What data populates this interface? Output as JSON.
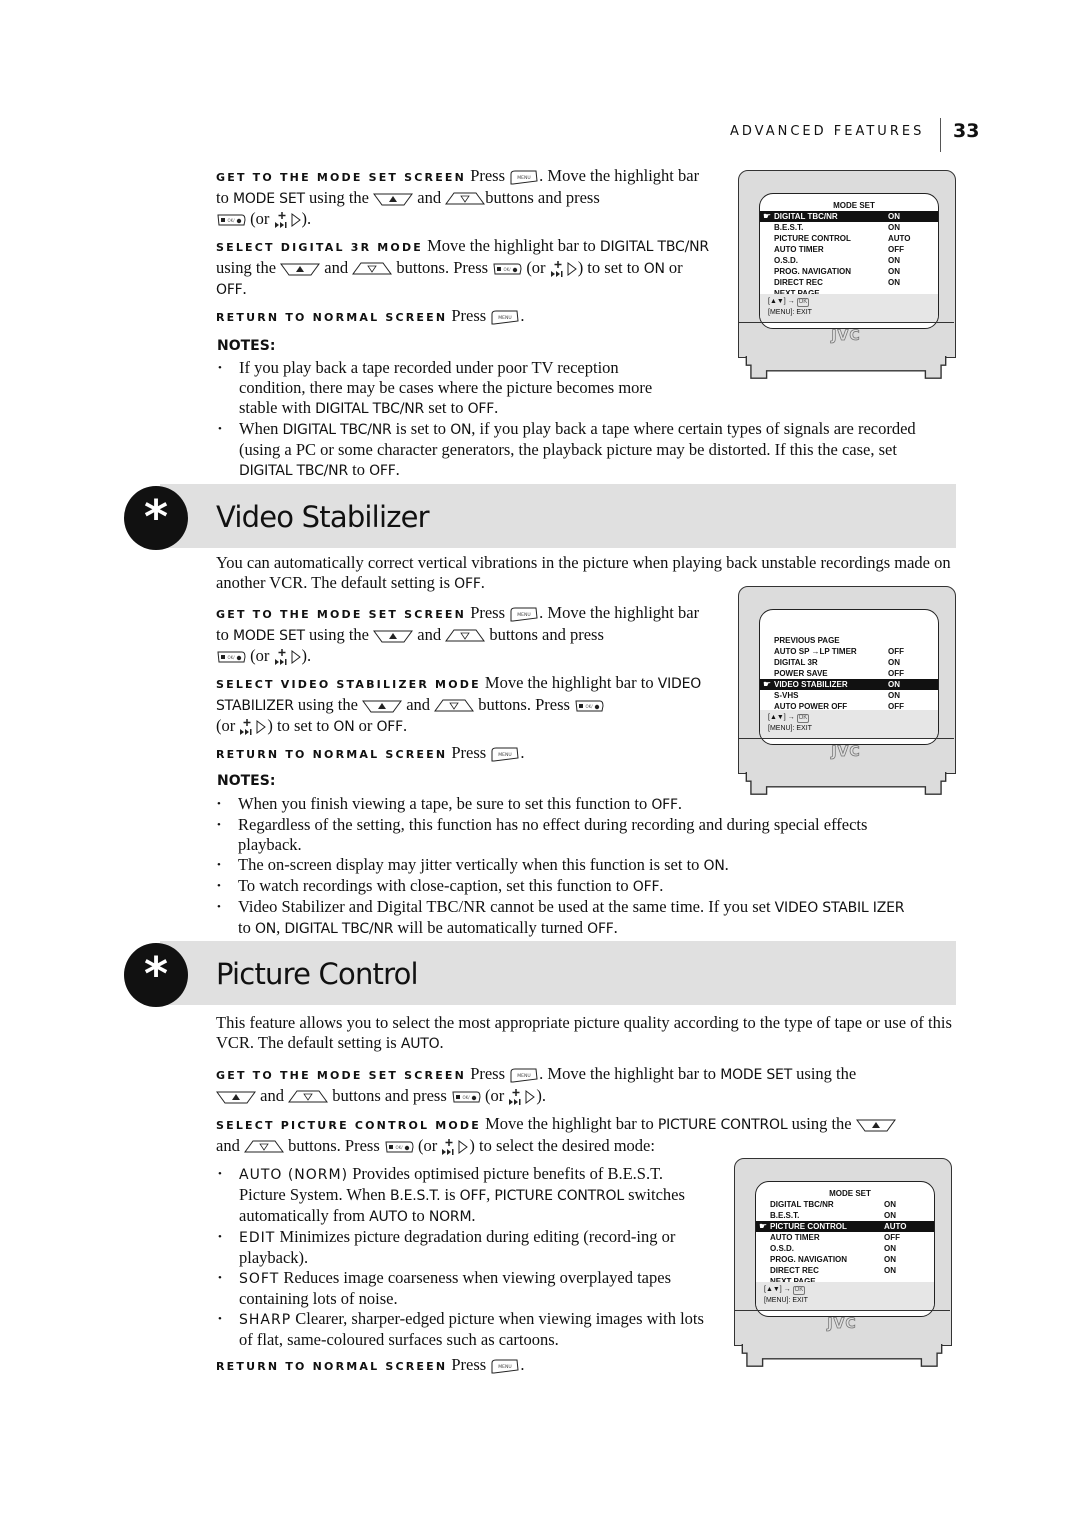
{
  "header": {
    "section": "ADVANCED FEATURES",
    "page_number": "33"
  },
  "icons": {
    "menu": "menu-button-icon",
    "up": "up-arrow-button-icon",
    "down": "down-arrow-button-icon",
    "ok": "ok-button-icon",
    "plus_next": "plus-skip-button-icon",
    "right": "right-triangle-icon",
    "section": "asterisk-icon"
  },
  "digital3r": {
    "get": {
      "lead": "GET TO THE MODE SET SCREEN",
      "t1": " Press ",
      "t2": ". Move the highlight bar to ",
      "b1": "MODE SET",
      "t3": " using the ",
      "t4": " and ",
      "t5": "buttons and press ",
      "t6": " (or ",
      "t7": ")."
    },
    "select": {
      "lead": "SELECT DIGITAL 3R MODE",
      "t1": " Move the highlight bar to ",
      "b1": "DIGITAL TBC/NR",
      "t2": " using the ",
      "t3": " and ",
      "t4": " buttons. Press ",
      "t5": " (or ",
      "t6": ") to set to ",
      "b2": "ON",
      "t7": " or ",
      "b3": "OFF",
      "t8": "."
    },
    "return": {
      "lead": "RETURN TO NORMAL SCREEN",
      "t1": "  Press ",
      "t2": "."
    },
    "notes_heading": "NOTES:",
    "notes": [
      {
        "a": "If you play back a tape recorded under poor TV reception condition, there may be cases where the picture becomes more stable with ",
        "b": "DIGITAL TBC/NR",
        "c": " set to ",
        "d": "OFF",
        "e": "."
      },
      {
        "a": "When ",
        "b": "DIGITAL TBC/NR",
        "c": " is set to ",
        "d": "ON",
        "e": ", if you play back a tape where certain types of signals are recorded (using a PC or some character generators, the playback picture may be distorted. If this the case, set ",
        "f": "DIGITAL TBC/NR",
        "g": " to ",
        "h": "OFF",
        "i": "."
      }
    ],
    "tv": {
      "title": "MODE SET",
      "rows": [
        {
          "label": "DIGITAL TBC/NR",
          "value": "ON",
          "highlighted": true
        },
        {
          "label": "B.E.S.T.",
          "value": "ON"
        },
        {
          "label": "PICTURE CONTROL",
          "value": "AUTO"
        },
        {
          "label": "AUTO TIMER",
          "value": "OFF"
        },
        {
          "label": "O.S.D.",
          "value": "ON"
        },
        {
          "label": "PROG. NAVIGATION",
          "value": "ON"
        },
        {
          "label": "DIRECT REC",
          "value": "ON"
        },
        {
          "label": "NEXT PAGE",
          "value": ""
        }
      ],
      "help1_pre": "[▲▼] → ",
      "help1_ok": "OK",
      "help2": "[MENU]: EXIT",
      "brand": "JVC"
    }
  },
  "video_stabilizer": {
    "title": "Video Stabilizer",
    "intro_a": "You can automatically correct vertical vibrations in the picture when playing back unstable recordings made on another VCR. The default setting is ",
    "intro_b": "OFF",
    "intro_c": ".",
    "get": {
      "lead": "GET TO THE MODE SET SCREEN",
      "t1": " Press ",
      "t2": ". Move the highlight bar to ",
      "b1": "MODE SET",
      "t3": " using the ",
      "t4": " and ",
      "t5": " buttons and press ",
      "t6": " (or ",
      "t7": ")."
    },
    "select": {
      "lead": "SELECT VIDEO STABILIZER MODE",
      "t1": " Move the highlight bar to ",
      "b1": "VIDEO STABILIZER",
      "t2": " using the ",
      "t3": " and ",
      "t4": " buttons. Press ",
      "t5": " (or ",
      "t6": ") to set to ",
      "b2": "ON",
      "t7": " or ",
      "b3": "OFF",
      "t8": "."
    },
    "return": {
      "lead": "RETURN TO NORMAL SCREEN",
      "t1": "  Press ",
      "t2": "."
    },
    "notes_heading": "NOTES:",
    "notes": [
      {
        "a": "When you finish viewing a tape, be sure to set this function to ",
        "b": "OFF",
        "c": "."
      },
      {
        "a": "Regardless of the setting, this function has no effect during recording and during special effects playback."
      },
      {
        "a": "The on-screen display may jitter vertically when this function is set to ",
        "b": "ON",
        "c": "."
      },
      {
        "a": "To watch recordings with close-caption, set this function to ",
        "b": "OFF",
        "c": "."
      },
      {
        "a": "Video Stabilizer and Digital TBC/NR cannot be used at the same time. If you set ",
        "b": "VIDEO STABIL IZER",
        "c": " to ",
        "d": "ON",
        "e": ", ",
        "f": "DIGITAL TBC/NR",
        "g": " will be automatically turned ",
        "h": "OFF",
        "i": "."
      }
    ],
    "tv": {
      "title": "",
      "rows": [
        {
          "label": "PREVIOUS PAGE",
          "value": ""
        },
        {
          "label": "AUTO SP →LP TIMER",
          "value": "OFF"
        },
        {
          "label": "DIGITAL 3R",
          "value": "ON"
        },
        {
          "label": "POWER SAVE",
          "value": "OFF"
        },
        {
          "label": "VIDEO STABILIZER",
          "value": "ON",
          "highlighted": true
        },
        {
          "label": "S-VHS",
          "value": "ON"
        },
        {
          "label": "AUTO POWER OFF",
          "value": "OFF"
        }
      ],
      "help1_pre": "[▲▼] → ",
      "help1_ok": "OK",
      "help2": "[MENU]: EXIT",
      "brand": "JVC"
    }
  },
  "picture_control": {
    "title": "Picture Control",
    "intro_a": "This feature allows you to select the most appropriate picture quality according to the type of tape or use of this VCR. The default setting is ",
    "intro_b": "AUTO",
    "intro_c": ".",
    "get": {
      "lead": "GET TO THE MODE SET SCREEN",
      "t1": " Press ",
      "t2": ". Move the highlight bar to ",
      "b1": "MODE SET",
      "t3": " using the ",
      "t4": " and ",
      "t5": " buttons and press ",
      "t6": " (or ",
      "t7": ")."
    },
    "select": {
      "lead": "SELECT PICTURE CONTROL MODE",
      "t1": " Move the highlight bar to ",
      "b1": "PICTURE CONTROL",
      "t2": " using the ",
      "t3": " and ",
      "t4": " buttons. Press ",
      "t5": " (or ",
      "t6": ") to select the desired mode:"
    },
    "modes": [
      {
        "name": "AUTO (NORM)",
        "a": "  Provides optimised picture benefits of B.E.S.T. Picture System. When ",
        "b": "B.E.S.T.",
        "c": " is ",
        "d": "OFF",
        "e": ", ",
        "f": "PICTURE CONTROL",
        "g": " switches automatically from ",
        "h": "AUTO",
        "i": " to ",
        "j": "NORM",
        "k": "."
      },
      {
        "name": "EDIT",
        "a": "  Minimizes picture degradation during editing (record-ing or playback)."
      },
      {
        "name": "SOFT",
        "a": "  Reduces image coarseness when viewing overplayed tapes containing lots of noise."
      },
      {
        "name": "SHARP",
        "a": "  Clearer, sharper-edged picture when viewing images with lots of flat, same-coloured surfaces such as cartoons."
      }
    ],
    "return": {
      "lead": "RETURN TO NORMAL SCREEN",
      "t1": "  Press ",
      "t2": "."
    },
    "tv": {
      "title": "MODE SET",
      "rows": [
        {
          "label": "DIGITAL TBC/NR",
          "value": "ON"
        },
        {
          "label": "B.E.S.T.",
          "value": "ON"
        },
        {
          "label": "PICTURE CONTROL",
          "value": "AUTO",
          "highlighted": true
        },
        {
          "label": "AUTO TIMER",
          "value": "OFF"
        },
        {
          "label": "O.S.D.",
          "value": "ON"
        },
        {
          "label": "PROG. NAVIGATION",
          "value": "ON"
        },
        {
          "label": "DIRECT REC",
          "value": "ON"
        },
        {
          "label": "NEXT PAGE",
          "value": ""
        }
      ],
      "help1_pre": "[▲▼] → ",
      "help1_ok": "OK",
      "help2": "[MENU]: EXIT",
      "brand": "JVC"
    }
  }
}
